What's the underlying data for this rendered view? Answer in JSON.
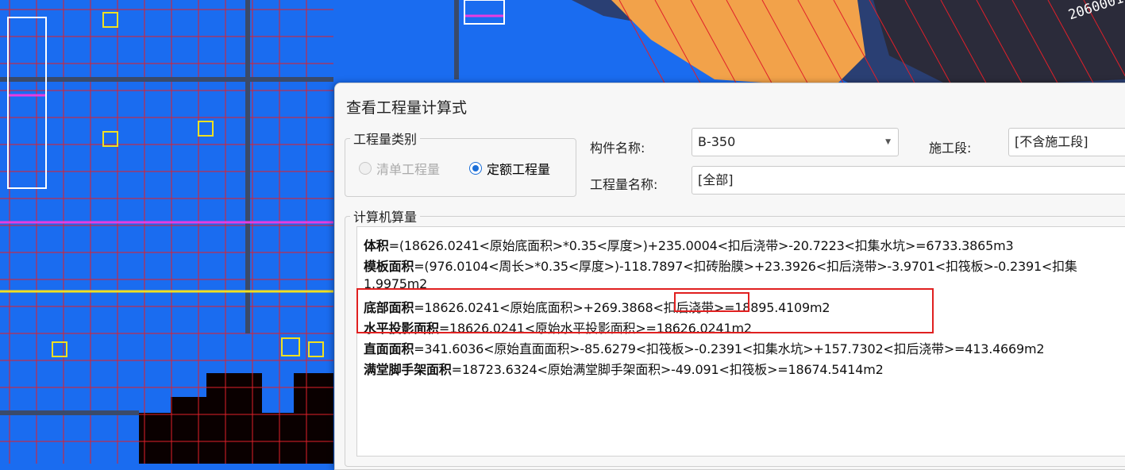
{
  "dialog": {
    "title": "查看工程量计算式",
    "quantity_type": {
      "legend": "工程量类别",
      "options": [
        {
          "label": "清单工程量",
          "selected": false,
          "enabled": false
        },
        {
          "label": "定额工程量",
          "selected": true,
          "enabled": true
        }
      ]
    },
    "component_name": {
      "label": "构件名称:",
      "value": "B-350"
    },
    "construction_stage": {
      "label": "施工段:",
      "value": "[不含施工段]"
    },
    "quantity_name": {
      "label": "工程量名称:",
      "value": "[全部]"
    },
    "computer_calc": {
      "legend": "计算机算量",
      "lines": [
        {
          "term": "体积",
          "expr": "=(18626.0241<原始底面积>*0.35<厚度>)+235.0004<扣后浇带>-20.7223<扣集水坑>=6733.3865m3"
        },
        {
          "term": "模板面积",
          "expr": "=(976.0104<周长>*0.35<厚度>)-118.7897<扣砖胎膜>+23.3926<扣后浇带>-3.9701<扣筏板>-0.2391<扣集"
        },
        {
          "term": "",
          "expr": "1.9975m2"
        },
        {
          "term": "底部面积",
          "expr": "=18626.0241<原始底面积>+269.3868<扣后浇带>=18895.4109m2"
        },
        {
          "term": "水平投影面积",
          "expr": "=18626.0241<原始水平投影面积>=18626.0241m2"
        },
        {
          "term": "直面面积",
          "expr": "=341.6036<原始直面面积>-85.6279<扣筏板>-0.2391<扣集水坑>+157.7302<扣后浇带>=413.4669m2"
        },
        {
          "term": "满堂脚手架面积",
          "expr": "=18723.6324<原始满堂脚手架面积>-49.091<扣筏板>=18674.5414m2"
        }
      ]
    }
  },
  "background": {
    "label": "2060001"
  },
  "colors": {
    "cad_bg": "#1a6cf0",
    "grid": "#e0202a",
    "highlight": "#e02020",
    "radio": "#1c6fd8"
  },
  "icons": {
    "combo_arrow": "chevron-down-icon"
  }
}
